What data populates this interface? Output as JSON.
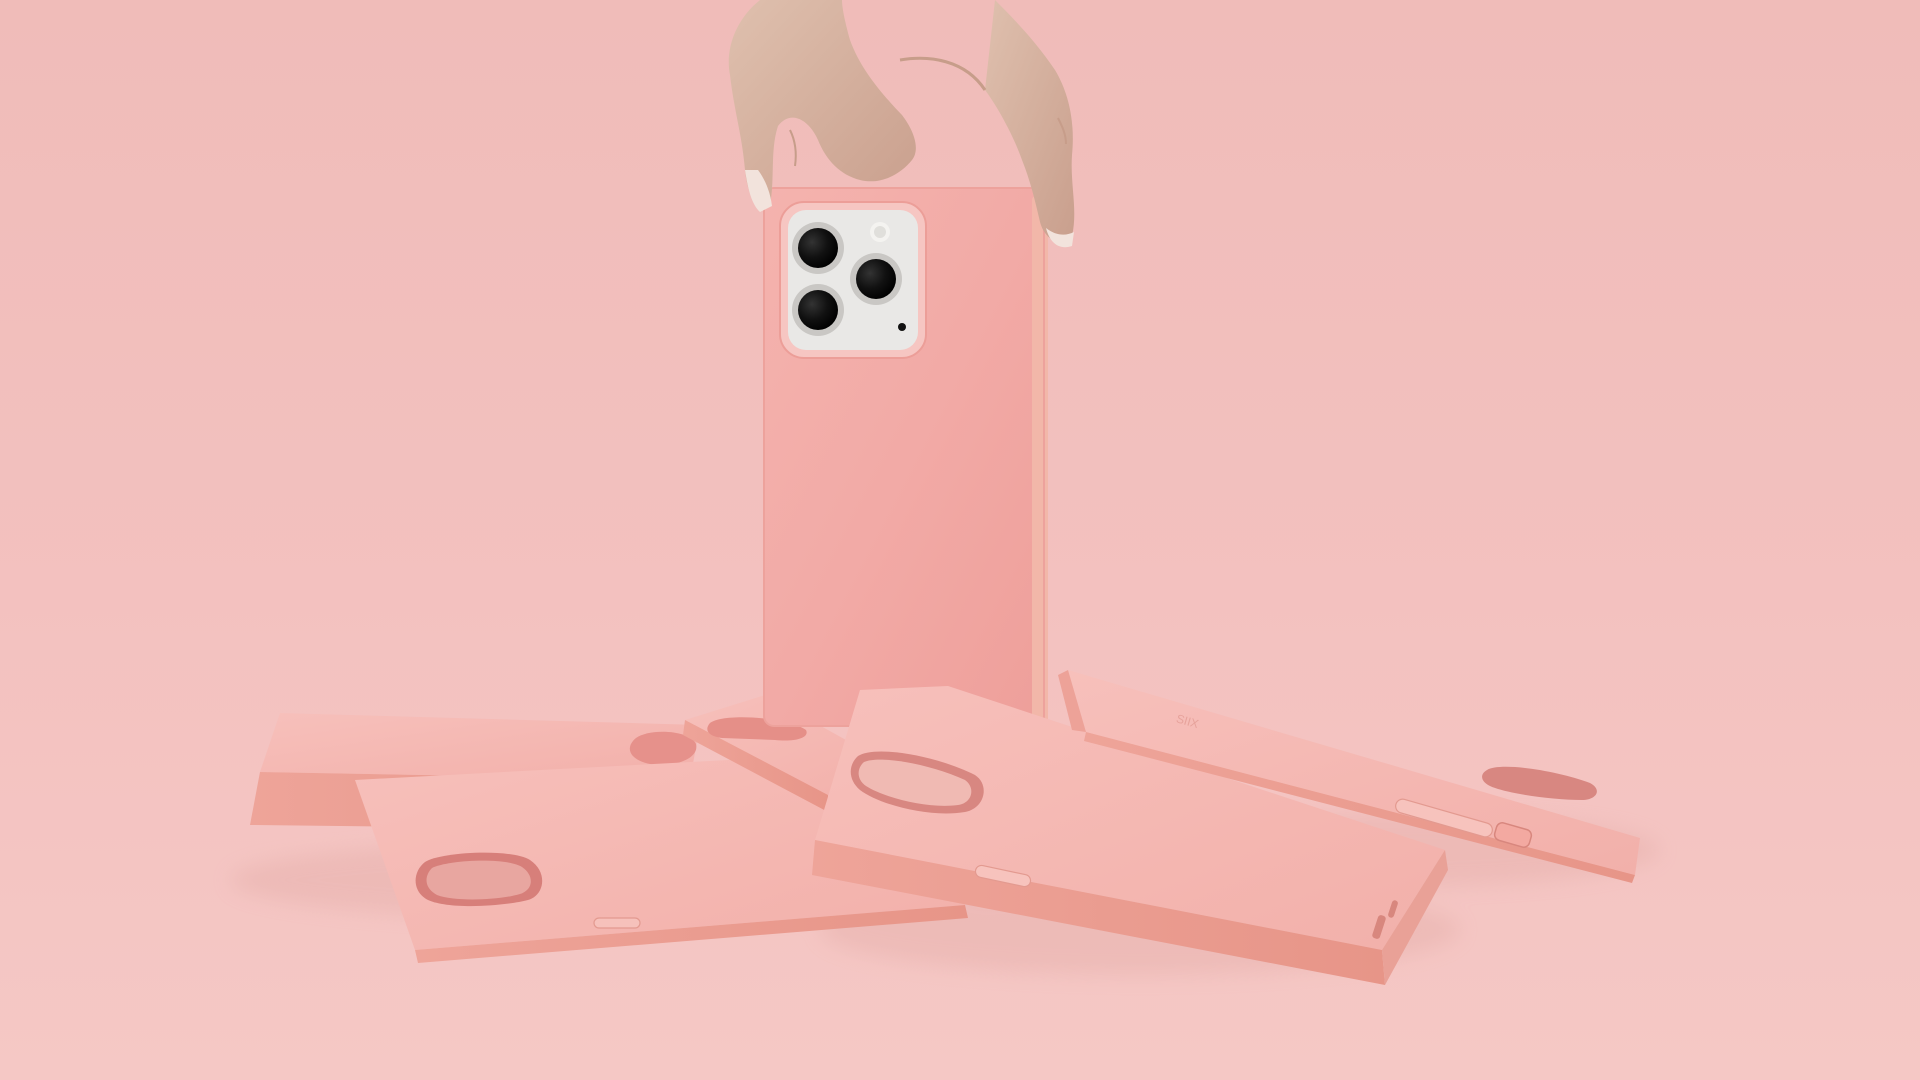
{
  "colors": {
    "background_top": "#f0bcb9",
    "background_bottom": "#f5c8c5",
    "case_main": "#f2aaa6",
    "case_light": "#f6b8b2",
    "case_shadow": "#e79d96",
    "case_edge": "#e89a90",
    "phone_silver": "#e9e8e6",
    "lens_black": "#111111",
    "skin": "#d8b6a3",
    "skin_shadow": "#c79d8a",
    "nail": "#f2e3dc"
  },
  "icons": {
    "camera_cutout": "camera-cutout-icon",
    "phone_lens": "phone-lens-icon",
    "side_button": "side-button-icon"
  },
  "branding": {
    "case_imprint": "SIIX"
  }
}
